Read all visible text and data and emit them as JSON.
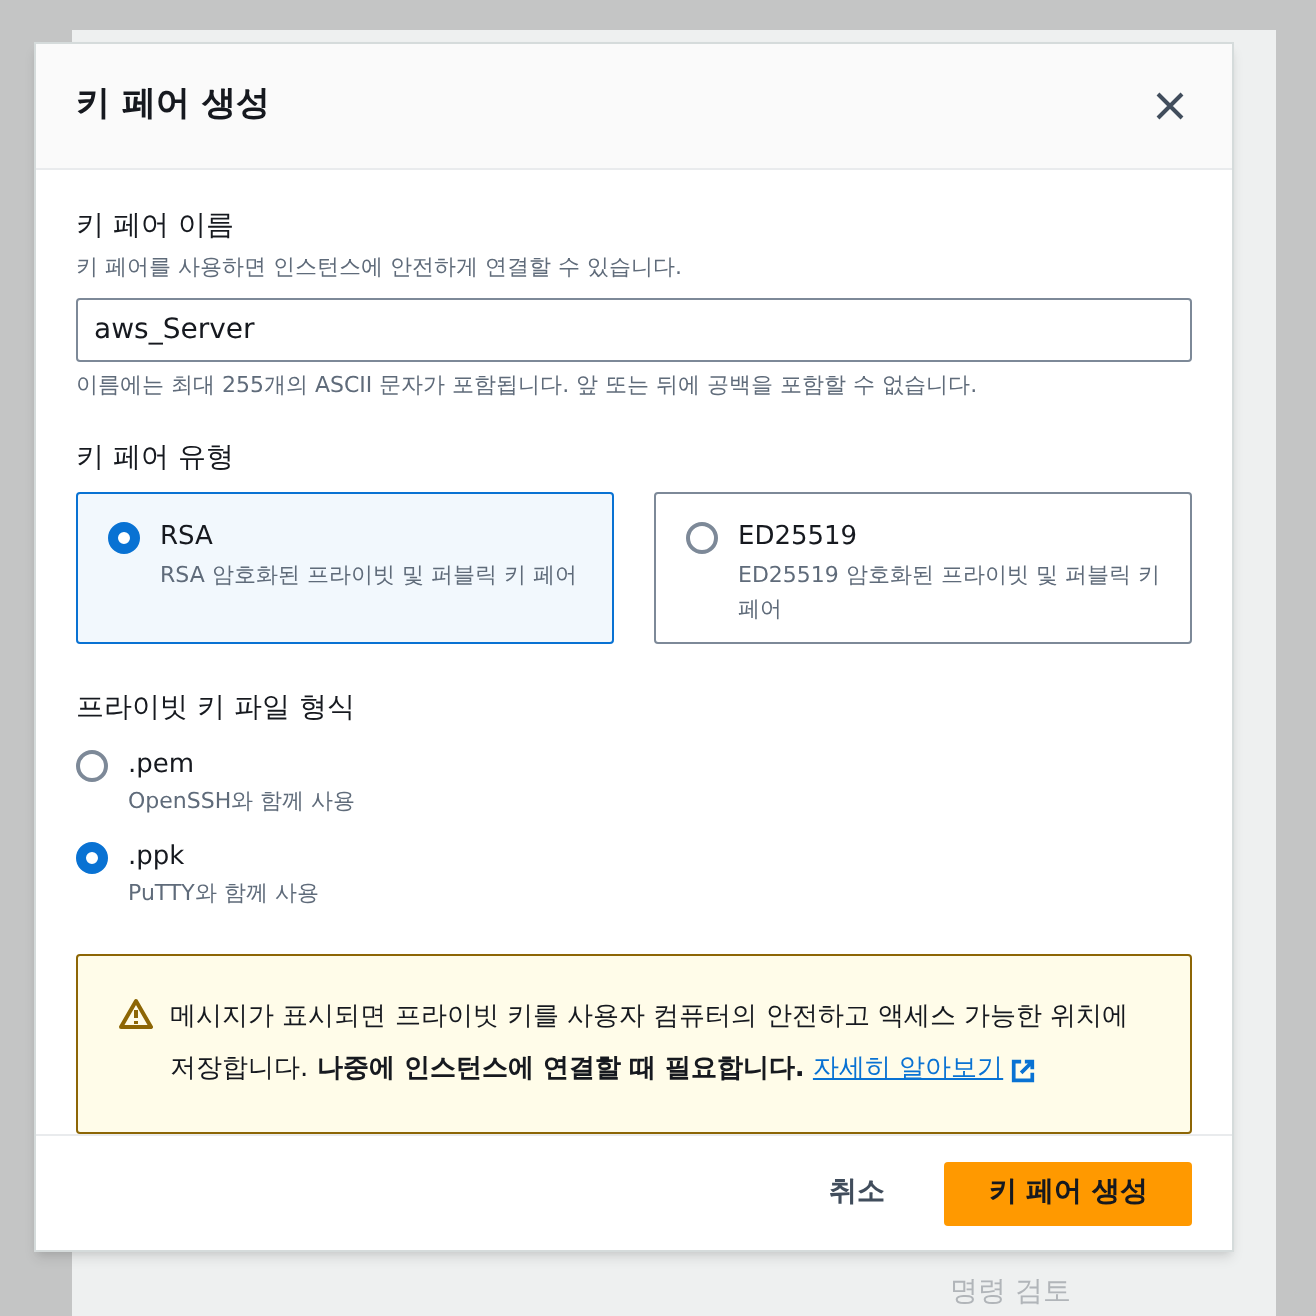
{
  "background": {
    "review_button": "명령 검토"
  },
  "dialog": {
    "title": "키 페어 생성",
    "name_field": {
      "label": "키 페어 이름",
      "description": "키 페어를 사용하면 인스턴스에 안전하게 연결할 수 있습니다.",
      "value": "aws_Server",
      "hint": "이름에는 최대 255개의 ASCII 문자가 포함됩니다. 앞 또는 뒤에 공백을 포함할 수 없습니다."
    },
    "key_type": {
      "label": "키 페어 유형",
      "options": [
        {
          "label": "RSA",
          "description": "RSA 암호화된 프라이빗 및 퍼블릭 키 페어",
          "selected": true
        },
        {
          "label": "ED25519",
          "description": "ED25519 암호화된 프라이빗 및 퍼블릭 키 페어",
          "selected": false
        }
      ]
    },
    "file_format": {
      "label": "프라이빗 키 파일 형식",
      "options": [
        {
          "label": ".pem",
          "description": "OpenSSH와 함께 사용",
          "selected": false
        },
        {
          "label": ".ppk",
          "description": "PuTTY와 함께 사용",
          "selected": true
        }
      ]
    },
    "alert": {
      "text": "메시지가 표시되면 프라이빗 키를 사용자 컴퓨터의 안전하고 액세스 가능한 위치에 저장합니다. **나중에 인스턴스에 연결할 때 필요합니다.**",
      "link": "자세히 알아보기"
    },
    "buttons": {
      "cancel": "취소",
      "submit": "키 페어 생성"
    }
  }
}
